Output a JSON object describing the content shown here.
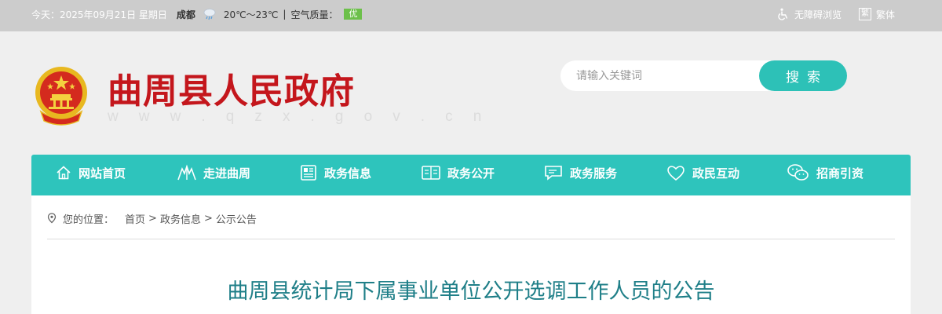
{
  "topbar": {
    "date": "今天：2025年09月21日 星期日",
    "city": "成都",
    "weather_icon": "rain-cloud-icon",
    "temperature": "20℃～23℃",
    "separator": "|",
    "air_quality_label": "空气质量：",
    "air_quality_value": "优",
    "accessibility_label": "无障碍浏览",
    "traditional_label": "繁体",
    "traditional_icon_glyph": "繁"
  },
  "header": {
    "title": "曲周县人民政府",
    "url_text": "w w w . q z x . g o v . c n",
    "emblem_icon": "national-emblem-icon"
  },
  "search": {
    "placeholder": "请输入关键词",
    "button_label": "搜索"
  },
  "nav": {
    "items": [
      {
        "label": "网站首页",
        "icon": "home-icon"
      },
      {
        "label": "走进曲周",
        "icon": "landmark-icon"
      },
      {
        "label": "政务信息",
        "icon": "document-icon"
      },
      {
        "label": "政务公开",
        "icon": "open-book-icon"
      },
      {
        "label": "政务服务",
        "icon": "chat-bubble-icon"
      },
      {
        "label": "政民互动",
        "icon": "heart-icon"
      },
      {
        "label": "招商引资",
        "icon": "wechat-icon"
      }
    ]
  },
  "breadcrumb": {
    "prefix": "您的位置：",
    "items": [
      "首页",
      "政务信息",
      "公示公告"
    ],
    "arrow": ">"
  },
  "article": {
    "title": "曲周县统计局下属事业单位公开选调工作人员的公告"
  },
  "colors": {
    "accent": "#2ec4bc",
    "title_red": "#c4161c",
    "article_title": "#1f7f88",
    "aq_badge": "#6cc04a"
  }
}
